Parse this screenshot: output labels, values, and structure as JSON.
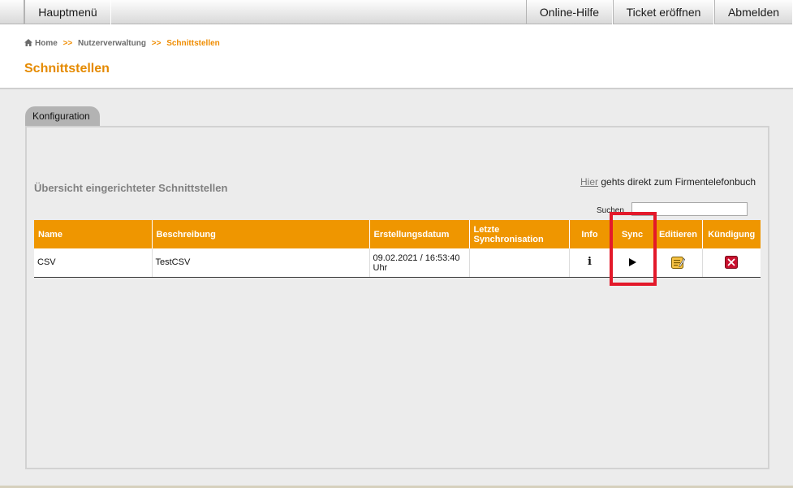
{
  "nav": {
    "main_menu": "Hauptmenü",
    "help": "Online-Hilfe",
    "ticket": "Ticket eröffnen",
    "logout": "Abmelden"
  },
  "breadcrumb": {
    "home": "Home",
    "separator": ">>",
    "level2": "Nutzerverwaltung",
    "current": "Schnittstellen"
  },
  "page": {
    "title": "Schnittstellen"
  },
  "tabs": [
    {
      "label": "Konfiguration"
    }
  ],
  "overview": {
    "title": "Übersicht eingerichteter Schnittstellen",
    "phonebook_link": "Hier",
    "phonebook_text": " gehts direkt zum Firmentelefonbuch",
    "search_label": "Suchen",
    "search_value": ""
  },
  "table": {
    "headers": {
      "name": "Name",
      "description": "Beschreibung",
      "created": "Erstellungsdatum",
      "last_sync": "Letzte Synchronisation",
      "info": "Info",
      "sync": "Sync",
      "edit": "Editieren",
      "cancel": "Kündigung"
    },
    "rows": [
      {
        "name": "CSV",
        "description": "TestCSV",
        "created": "09.02.2021 / 16:53:40 Uhr",
        "last_sync": "",
        "info_icon": "info-icon",
        "sync_icon": "play-icon",
        "edit_icon": "edit-icon",
        "cancel_icon": "cancel-icon"
      }
    ]
  },
  "colors": {
    "accent": "#ef9600",
    "title": "#e58a00",
    "highlight": "#e3192a"
  }
}
